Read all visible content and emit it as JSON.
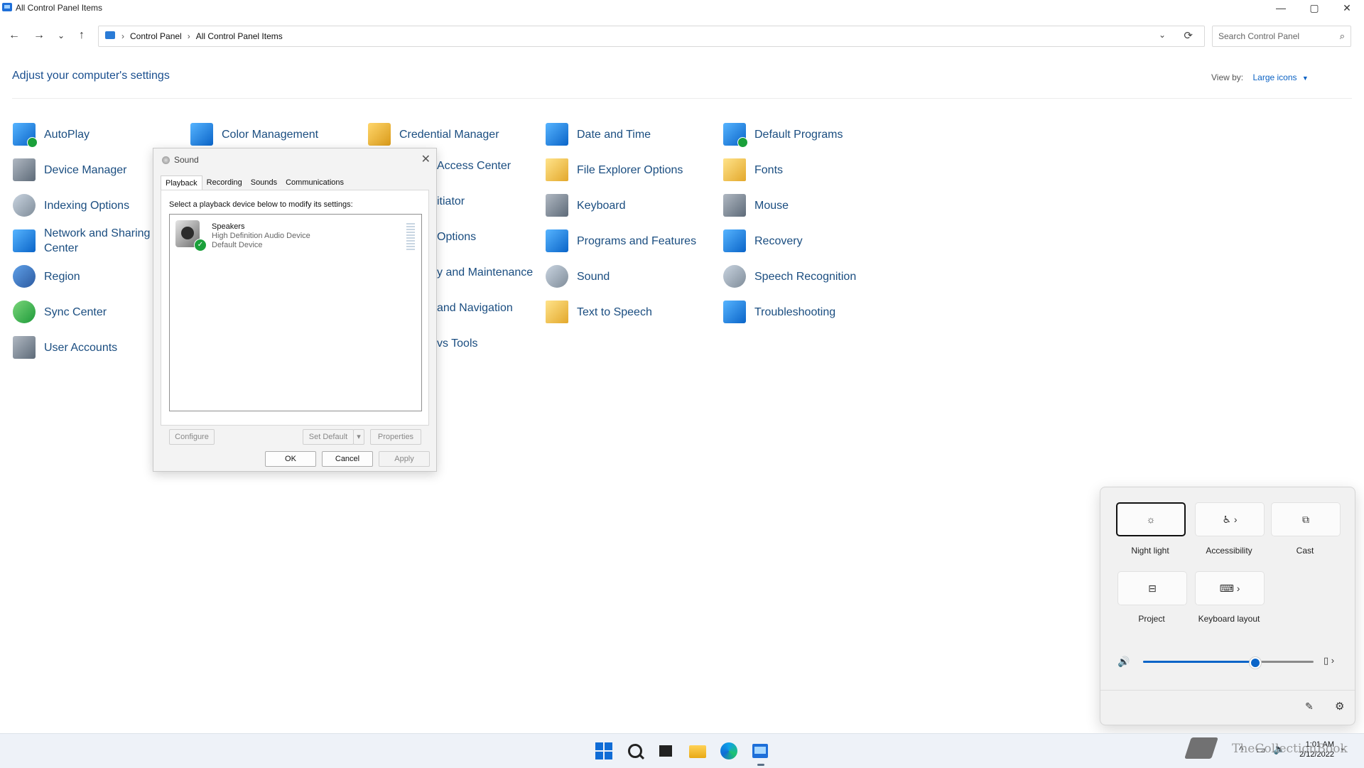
{
  "window": {
    "title": "All Control Panel Items",
    "controls": {
      "minimize": "—",
      "maximize": "▢",
      "close": "✕"
    }
  },
  "nav": {
    "back": "←",
    "forward": "→",
    "recent": "⌄",
    "up": "↑",
    "breadcrumbs": [
      "Control Panel",
      "All Control Panel Items"
    ],
    "separator": "›",
    "dropdown": "⌄",
    "refresh": "⟳",
    "search_placeholder": "Search Control Panel",
    "search_icon": "⌕"
  },
  "main": {
    "heading": "Adjust your computer's settings",
    "view_by_label": "View by:",
    "view_by_value": "Large icons",
    "view_by_caret": "▼",
    "items": [
      {
        "label": "AutoPlay",
        "icon": "autoplay-icon"
      },
      {
        "label": "Color Management",
        "icon": "color-management-icon"
      },
      {
        "label": "Credential Manager",
        "icon": "credential-manager-icon"
      },
      {
        "label": "Date and Time",
        "icon": "date-time-icon"
      },
      {
        "label": "Default Programs",
        "icon": "default-programs-icon"
      },
      {
        "label": "Device Manager",
        "icon": "device-manager-icon"
      },
      {
        "label": "Access Center",
        "icon": "ease-of-access-icon"
      },
      {
        "label": "File Explorer Options",
        "icon": "file-explorer-options-icon"
      },
      {
        "label": "Fonts",
        "icon": "fonts-icon"
      },
      {
        "label": "Indexing Options",
        "icon": "indexing-options-icon"
      },
      {
        "label": "itiator",
        "icon": "iscsi-initiator-icon"
      },
      {
        "label": "Keyboard",
        "icon": "keyboard-icon"
      },
      {
        "label": "Mouse",
        "icon": "mouse-icon"
      },
      {
        "label": "Network and Sharing Center",
        "icon": "network-sharing-icon"
      },
      {
        "label": "Options",
        "icon": "power-options-icon"
      },
      {
        "label": "Programs and Features",
        "icon": "programs-features-icon"
      },
      {
        "label": "Recovery",
        "icon": "recovery-icon"
      },
      {
        "label": "Region",
        "icon": "region-icon"
      },
      {
        "label": "y and Maintenance",
        "icon": "security-maintenance-icon"
      },
      {
        "label": "Sound",
        "icon": "sound-icon"
      },
      {
        "label": "Speech Recognition",
        "icon": "speech-recognition-icon"
      },
      {
        "label": "Sync Center",
        "icon": "sync-center-icon"
      },
      {
        "label": "and Navigation",
        "icon": "taskbar-navigation-icon"
      },
      {
        "label": "Text to Speech",
        "icon": "text-to-speech-icon"
      },
      {
        "label": "Troubleshooting",
        "icon": "troubleshooting-icon"
      },
      {
        "label": "User Accounts",
        "icon": "user-accounts-icon"
      },
      {
        "label": "vs Tools",
        "icon": "windows-tools-icon"
      }
    ]
  },
  "sound_dialog": {
    "title": "Sound",
    "close": "✕",
    "tabs": [
      "Playback",
      "Recording",
      "Sounds",
      "Communications"
    ],
    "instruction": "Select a playback device below to modify its settings:",
    "device": {
      "name": "Speakers",
      "description": "High Definition Audio Device",
      "status": "Default Device",
      "check": "✓"
    },
    "buttons": {
      "configure": "Configure",
      "set_default": "Set Default",
      "set_default_arrow": "▾",
      "properties": "Properties",
      "ok": "OK",
      "cancel": "Cancel",
      "apply": "Apply"
    }
  },
  "quick_settings": {
    "tiles": [
      {
        "label": "Night light",
        "glyph": "☼"
      },
      {
        "label": "Accessibility",
        "glyph": "♿ ›"
      },
      {
        "label": "Cast",
        "glyph": "⧉"
      },
      {
        "label": "Project",
        "glyph": "⊟"
      },
      {
        "label": "Keyboard layout",
        "glyph": "⌨ ›"
      }
    ],
    "volume_icon": "🔊",
    "volume_level": 0.66,
    "audio_output": "▯ ›",
    "edit": "✎",
    "settings": "⚙",
    "accent": "#0a64c8"
  },
  "taskbar": {
    "clock_time": "1:01 AM",
    "clock_date": "2/12/2022",
    "tray_chevron": "^",
    "tray_network": "▭",
    "tray_volume": "🔈",
    "notification": "◔"
  },
  "watermark": {
    "text": "TheCollectionBook"
  }
}
